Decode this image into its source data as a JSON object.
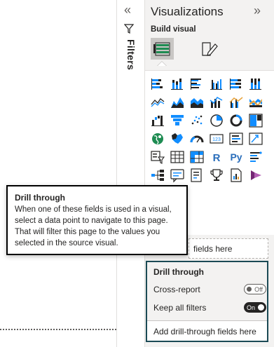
{
  "filters": {
    "label": "Filters",
    "collapse_icon": "«"
  },
  "visualizations": {
    "title": "Visualizations",
    "expand_icon": "»",
    "build_visual_label": "Build visual",
    "more": "..."
  },
  "gallery_icons": [
    "stacked-bar-icon",
    "stacked-column-icon",
    "clustered-bar-icon",
    "clustered-column-icon",
    "100-bar-icon",
    "100-column-icon",
    "line-chart-icon",
    "area-chart-icon",
    "stacked-area-icon",
    "line-column-icon",
    "line-clustered-column-icon",
    "ribbon-chart-icon",
    "waterfall-icon",
    "funnel-icon",
    "scatter-icon",
    "pie-icon",
    "donut-icon",
    "treemap-icon",
    "map-icon",
    "filled-map-icon",
    "gauge-icon",
    "card-icon",
    "multi-row-card-icon",
    "kpi-icon",
    "slicer-icon",
    "table-icon",
    "matrix-icon",
    "r-visual-icon",
    "python-visual-icon",
    "key-influencers-icon",
    "decomposition-tree-icon",
    "qa-icon",
    "smart-narrative-icon",
    "trophy-icon",
    "paginated-report-icon",
    "power-apps-icon"
  ],
  "gallery_glyphs": {
    "r": "R",
    "py": "Py",
    "card": "123"
  },
  "fields_placeholder_partial": "fields here",
  "drill_through": {
    "title": "Drill through",
    "cross_report_label": "Cross-report",
    "cross_report_state": "Off",
    "keep_filters_label": "Keep all filters",
    "keep_filters_state": "On",
    "add_fields_placeholder": "Add drill-through fields here"
  },
  "tooltip": {
    "title": "Drill through",
    "body": "When one of these fields is used in a visual, select a data point to navigate to this page. That will filter this page to the values you selected in the source visual."
  },
  "colors": {
    "accent_blue": "#118dff",
    "teal_border": "#1b4a55",
    "icon_dark": "#252423"
  }
}
